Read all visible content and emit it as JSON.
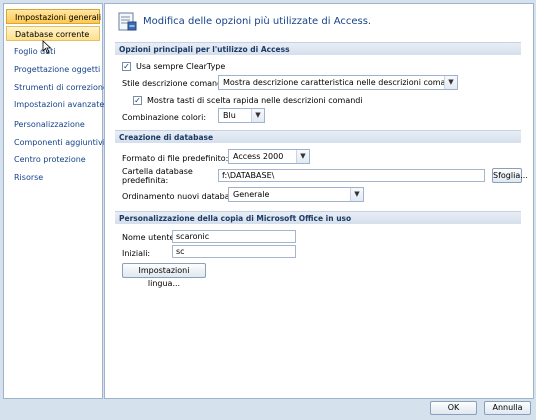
{
  "sidebar": {
    "items": [
      {
        "label": "Impostazioni generali"
      },
      {
        "label": "Database corrente"
      },
      {
        "label": "Foglio dati"
      },
      {
        "label": "Progettazione oggetti"
      },
      {
        "label": "Strumenti di correzione"
      },
      {
        "label": "Impostazioni avanzate"
      },
      {
        "label": "Personalizzazione"
      },
      {
        "label": "Componenti aggiuntivi"
      },
      {
        "label": "Centro protezione"
      },
      {
        "label": "Risorse"
      }
    ]
  },
  "header": {
    "title": "Modifica delle opzioni più utilizzate di Access."
  },
  "sections": {
    "main_options": {
      "title": "Opzioni principali per l'utilizzo di Access",
      "cleartype_label": "Usa sempre ClearType",
      "cleartype_checked": true,
      "tooltip_style_label": "Stile descrizione comando:",
      "tooltip_style_value": "Mostra descrizione caratteristica nelle descrizioni comando",
      "shortcut_keys_label": "Mostra tasti di scelta rapida nelle descrizioni comandi",
      "shortcut_keys_checked": true,
      "color_scheme_label": "Combinazione colori:",
      "color_scheme_value": "Blu"
    },
    "database": {
      "title": "Creazione di database",
      "file_format_label": "Formato di file predefinito:",
      "file_format_value": "Access 2000",
      "folder_label_line1": "Cartella database",
      "folder_label_line2": "predefinita:",
      "folder_value": "f:\\DATABASE\\",
      "browse_label": "Sfoglia...",
      "sort_label": "Ordinamento nuovi database:",
      "sort_value": "Generale"
    },
    "personalize": {
      "title": "Personalizzazione della copia di Microsoft Office in uso",
      "username_label": "Nome utente:",
      "username_value": "scaronic",
      "initials_label": "Iniziali:",
      "initials_value": "sc",
      "language_button": "Impostazioni lingua..."
    }
  },
  "footer": {
    "ok_label": "OK",
    "cancel_label": "Annulla"
  }
}
